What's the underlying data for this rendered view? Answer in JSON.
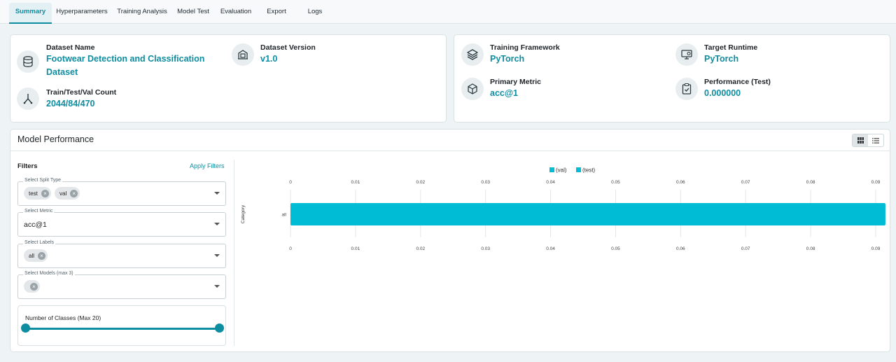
{
  "tabs": [
    {
      "label": "Summary",
      "active": true
    },
    {
      "label": "Hyperparameters",
      "active": false
    },
    {
      "label": "Training Analysis",
      "active": false
    },
    {
      "label": "Model Test",
      "active": false
    },
    {
      "label": "Evaluation",
      "active": false
    },
    {
      "label": "Export",
      "active": false
    },
    {
      "label": "Logs",
      "active": false
    }
  ],
  "dataset_card": {
    "name_label": "Dataset Name",
    "name_value": "Footwear Detection and Classification Dataset",
    "version_label": "Dataset Version",
    "version_value": "v1.0",
    "count_label": "Train/Test/Val Count",
    "count_value": "2044/84/470"
  },
  "model_card": {
    "framework_label": "Training Framework",
    "framework_value": "PyTorch",
    "runtime_label": "Target Runtime",
    "runtime_value": "PyTorch",
    "metric_label": "Primary Metric",
    "metric_value": "acc@1",
    "performance_label": "Performance (Test)",
    "performance_value": "0.000000"
  },
  "performance": {
    "title": "Model Performance",
    "filters_label": "Filters",
    "apply_label": "Apply Filters",
    "split_type": {
      "legend": "Select Split Type",
      "chips": [
        "test",
        "val"
      ]
    },
    "metric": {
      "legend": "Select Metric",
      "value": "acc@1"
    },
    "labels": {
      "legend": "Select Labels",
      "chips": [
        "all"
      ]
    },
    "models": {
      "legend": "Select Models (max 3)",
      "chips": [
        ""
      ]
    },
    "classes_slider": {
      "label": "Number of Classes (Max 20)"
    }
  },
  "chart_data": {
    "type": "bar",
    "orientation": "horizontal",
    "categories": [
      "all"
    ],
    "series": [
      {
        "name": "(val)",
        "values": [
          0.0
        ]
      },
      {
        "name": "(test)",
        "values": [
          0.0915
        ]
      }
    ],
    "x_ticks": [
      "0",
      "0.01",
      "0.02",
      "0.03",
      "0.04",
      "0.05",
      "0.06",
      "0.07",
      "0.08",
      "0.09"
    ],
    "xlim": [
      0,
      0.0915
    ],
    "ylabel": "Category",
    "legend_position": "top",
    "series_colors": [
      "#00bcd4",
      "#00bcd4"
    ]
  }
}
